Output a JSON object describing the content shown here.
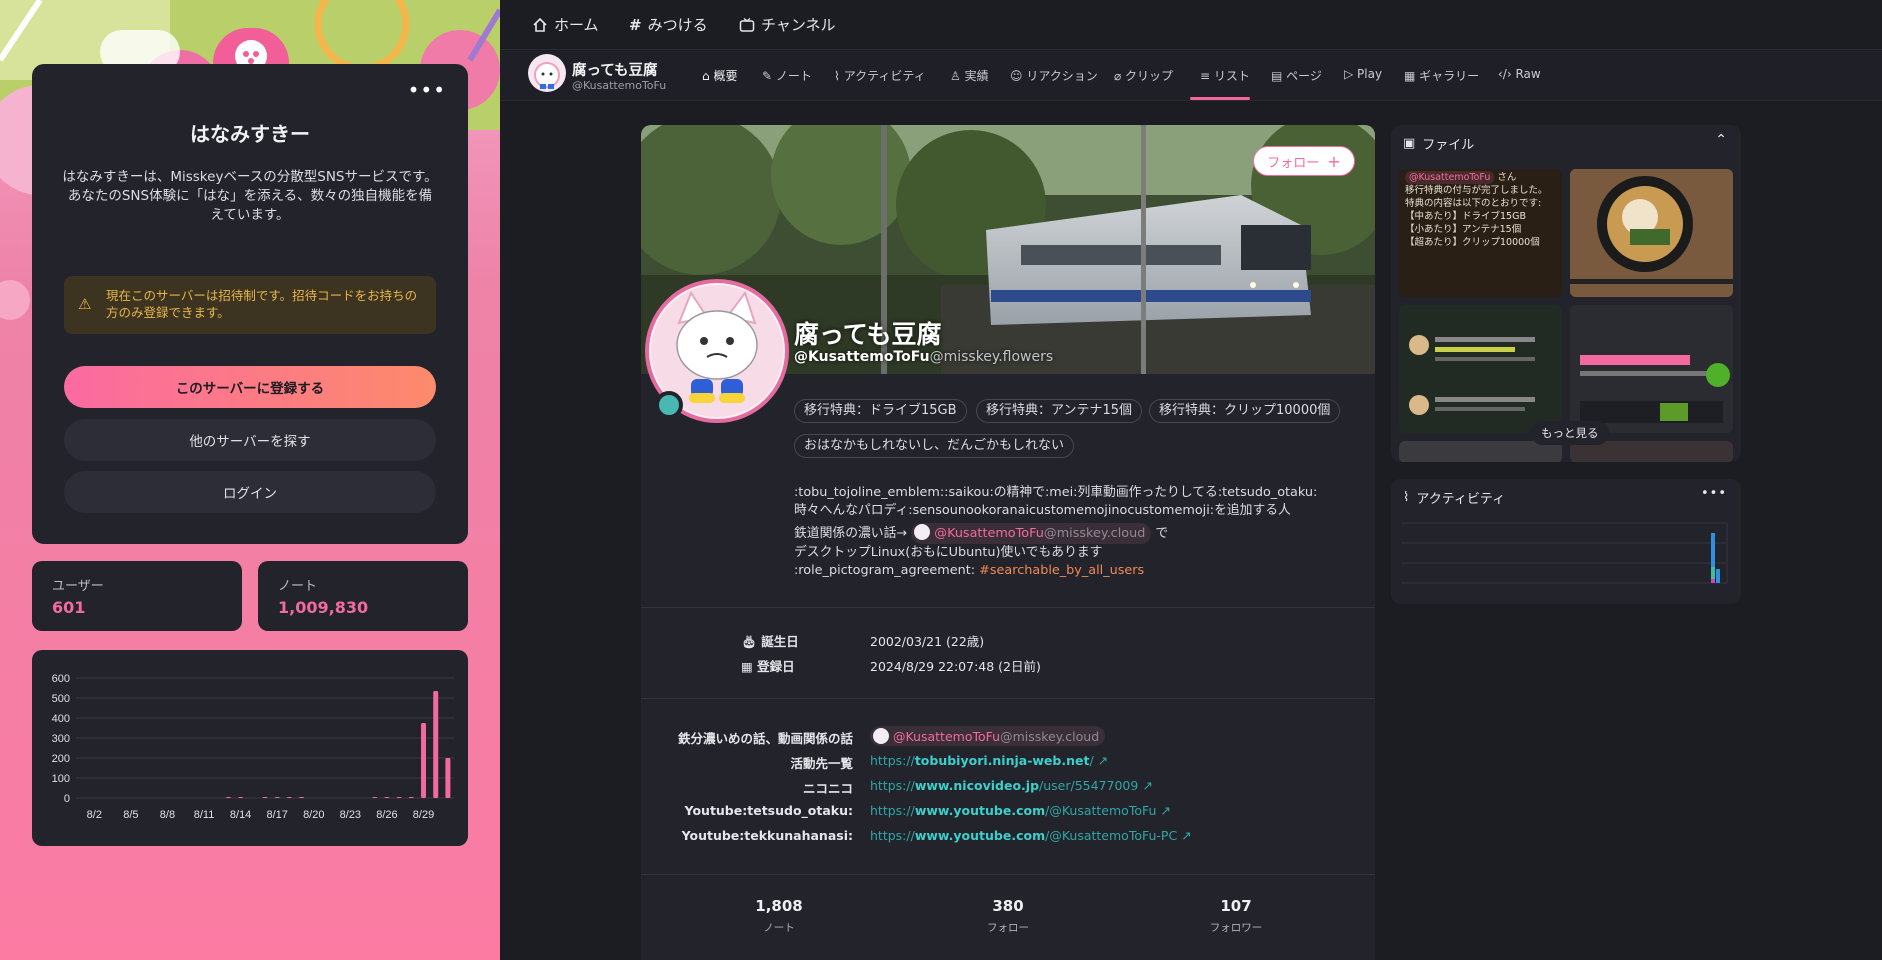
{
  "nav": {
    "home": "ホーム",
    "explore": "みつける",
    "channel": "チャンネル"
  },
  "welcome": {
    "title": "はなみすきー",
    "desc_line1": "はなみすきーは、Misskeyベースの分散型SNSサービスです。",
    "desc_line2": "あなたのSNS体験に「はな」を添える、数々の独自機能を備えています。",
    "warning": "現在このサーバーは招待制です。招待コードをお持ちの方のみ登録できます。",
    "register": "このサーバーに登録する",
    "other_server": "他のサーバーを探す",
    "login": "ログイン"
  },
  "stats": {
    "users_label": "ユーザー",
    "users_value": "601",
    "notes_label": "ノート",
    "notes_value": "1,009,830"
  },
  "chart_data": {
    "type": "bar",
    "categories": [
      "8/1",
      "8/2",
      "8/3",
      "8/4",
      "8/5",
      "8/6",
      "8/7",
      "8/8",
      "8/9",
      "8/10",
      "8/11",
      "8/12",
      "8/13",
      "8/14",
      "8/15",
      "8/16",
      "8/17",
      "8/18",
      "8/19",
      "8/20",
      "8/21",
      "8/22",
      "8/23",
      "8/24",
      "8/25",
      "8/26",
      "8/27",
      "8/28",
      "8/29",
      "8/30",
      "8/31"
    ],
    "values": [
      0,
      0,
      0,
      0,
      0,
      0,
      0,
      0,
      0,
      0,
      0,
      0,
      2,
      2,
      0,
      3,
      3,
      2,
      3,
      0,
      0,
      0,
      0,
      0,
      3,
      3,
      4,
      4,
      375,
      535,
      200
    ],
    "tick_labels": [
      "8/2",
      "8/5",
      "8/8",
      "8/11",
      "8/14",
      "8/17",
      "8/20",
      "8/23",
      "8/26",
      "8/29"
    ],
    "yticks": [
      0,
      100,
      200,
      300,
      400,
      500,
      600
    ],
    "ylim": [
      0,
      600
    ],
    "color": "#f26aa0",
    "grid": true
  },
  "profile": {
    "name": "腐っても豆腐",
    "acct": "@KusattemoToFu",
    "host": "@misskey.flowers",
    "follow": "フォロー",
    "chips": [
      "移行特典：ドライブ15GB",
      "移行特典：アンテナ15個",
      "移行特典：クリップ10000個",
      "おはなかもしれないし、だんごかもしれない"
    ],
    "bio_line1": ":tobu_tojoline_emblem::saikou:の精神で:mei:列車動画作ったりしてる:tetsudo_otaku:",
    "bio_line2": "時々へんなパロディ:sensounookoranaicustomemojinocustomemoji:を追加する人",
    "bio_line3_prefix": "鉄道関係の濃い話→",
    "bio_mention": "@KusattemoToFu",
    "bio_mention_host": "@misskey.cloud",
    "bio_line3_suffix": "で",
    "bio_line4": "デスクトップLinux(おもにUbuntu)使いでもあります",
    "bio_line5_prefix": ":role_pictogram_agreement:",
    "bio_tag": "#searchable_by_all_users",
    "birthday_label": "誕生日",
    "birthday": "2002/03/21 (22歳)",
    "joined_label": "登録日",
    "joined": "2024/8/29 22:07:48 (2日前)",
    "fields": [
      {
        "name": "鉄分濃いめの話、動画関係の話",
        "mention": "@KusattemoToFu",
        "mention_host": "@misskey.cloud"
      },
      {
        "name": "活動先一覧",
        "scheme": "https://",
        "domain": "tobubiyori.ninja-web.net",
        "path": "/"
      },
      {
        "name": "ニコニコ",
        "scheme": "https://",
        "domain": "www.nicovideo.jp",
        "path": "/user/55477009"
      },
      {
        "name": "Youtube:tetsudo_otaku:",
        "scheme": "https://",
        "domain": "www.youtube.com",
        "path": "/@KusattemoToFu"
      },
      {
        "name": "Youtube:tekkunahanasi:",
        "scheme": "https://",
        "domain": "www.youtube.com",
        "path": "/@KusattemoToFu-PC"
      }
    ],
    "notes_count": "1,808",
    "notes_label": "ノート",
    "following_count": "380",
    "following_label": "フォロー",
    "followers_count": "107",
    "followers_label": "フォロワー"
  },
  "tabs": [
    "概要",
    "ノート",
    "アクティビティ",
    "実績",
    "リアクション",
    "クリップ",
    "リスト",
    "ページ",
    "Play",
    "ギャラリー",
    "Raw"
  ],
  "files": {
    "title": "ファイル",
    "more": "もっと見る",
    "thumb1_mention": "@KusattemoToFu",
    "thumb1_text": "さん\n移行特典の付与が完了しました。\n特典の内容は以下のとおりです:\n【中あたり】ドライブ15GB\n【小あたり】アンテナ15個\n【超あたり】クリップ10000個"
  },
  "activity": {
    "title": "アクティビティ"
  },
  "colors": {
    "accent": "#f26aa0",
    "link": "#3cd0cc",
    "bg": "#1c1d23",
    "panel": "#22232b"
  }
}
